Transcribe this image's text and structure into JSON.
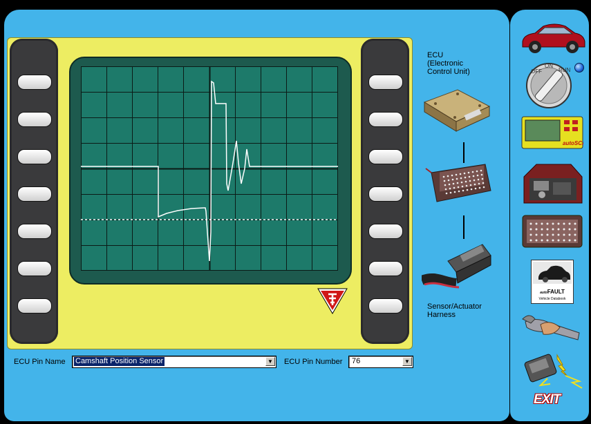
{
  "diagram": {
    "ecu_label_lines": [
      "ECU",
      "(Electronic",
      "Control Unit)"
    ],
    "harness_label_lines": [
      "Sensor/Actuator",
      "Harness"
    ]
  },
  "controls": {
    "pin_name_label": "ECU Pin Name",
    "pin_name_value": "Camshaft Position Sensor",
    "pin_number_label": "ECU Pin Number",
    "pin_number_value": "76"
  },
  "side_toolbar": {
    "ignition_labels": [
      "OFF",
      "ON",
      "RUN"
    ],
    "scanner_brand": "autoSCAN",
    "databook_title_small": "auto",
    "databook_title": "FAULT",
    "databook_subtitle": "Vehicle Databook",
    "exit_label": "EXIT"
  },
  "colors": {
    "panel": "#43b4ea",
    "scope_body": "#eded62",
    "screen": "#1d7a6a",
    "trace": "#ffffff"
  }
}
